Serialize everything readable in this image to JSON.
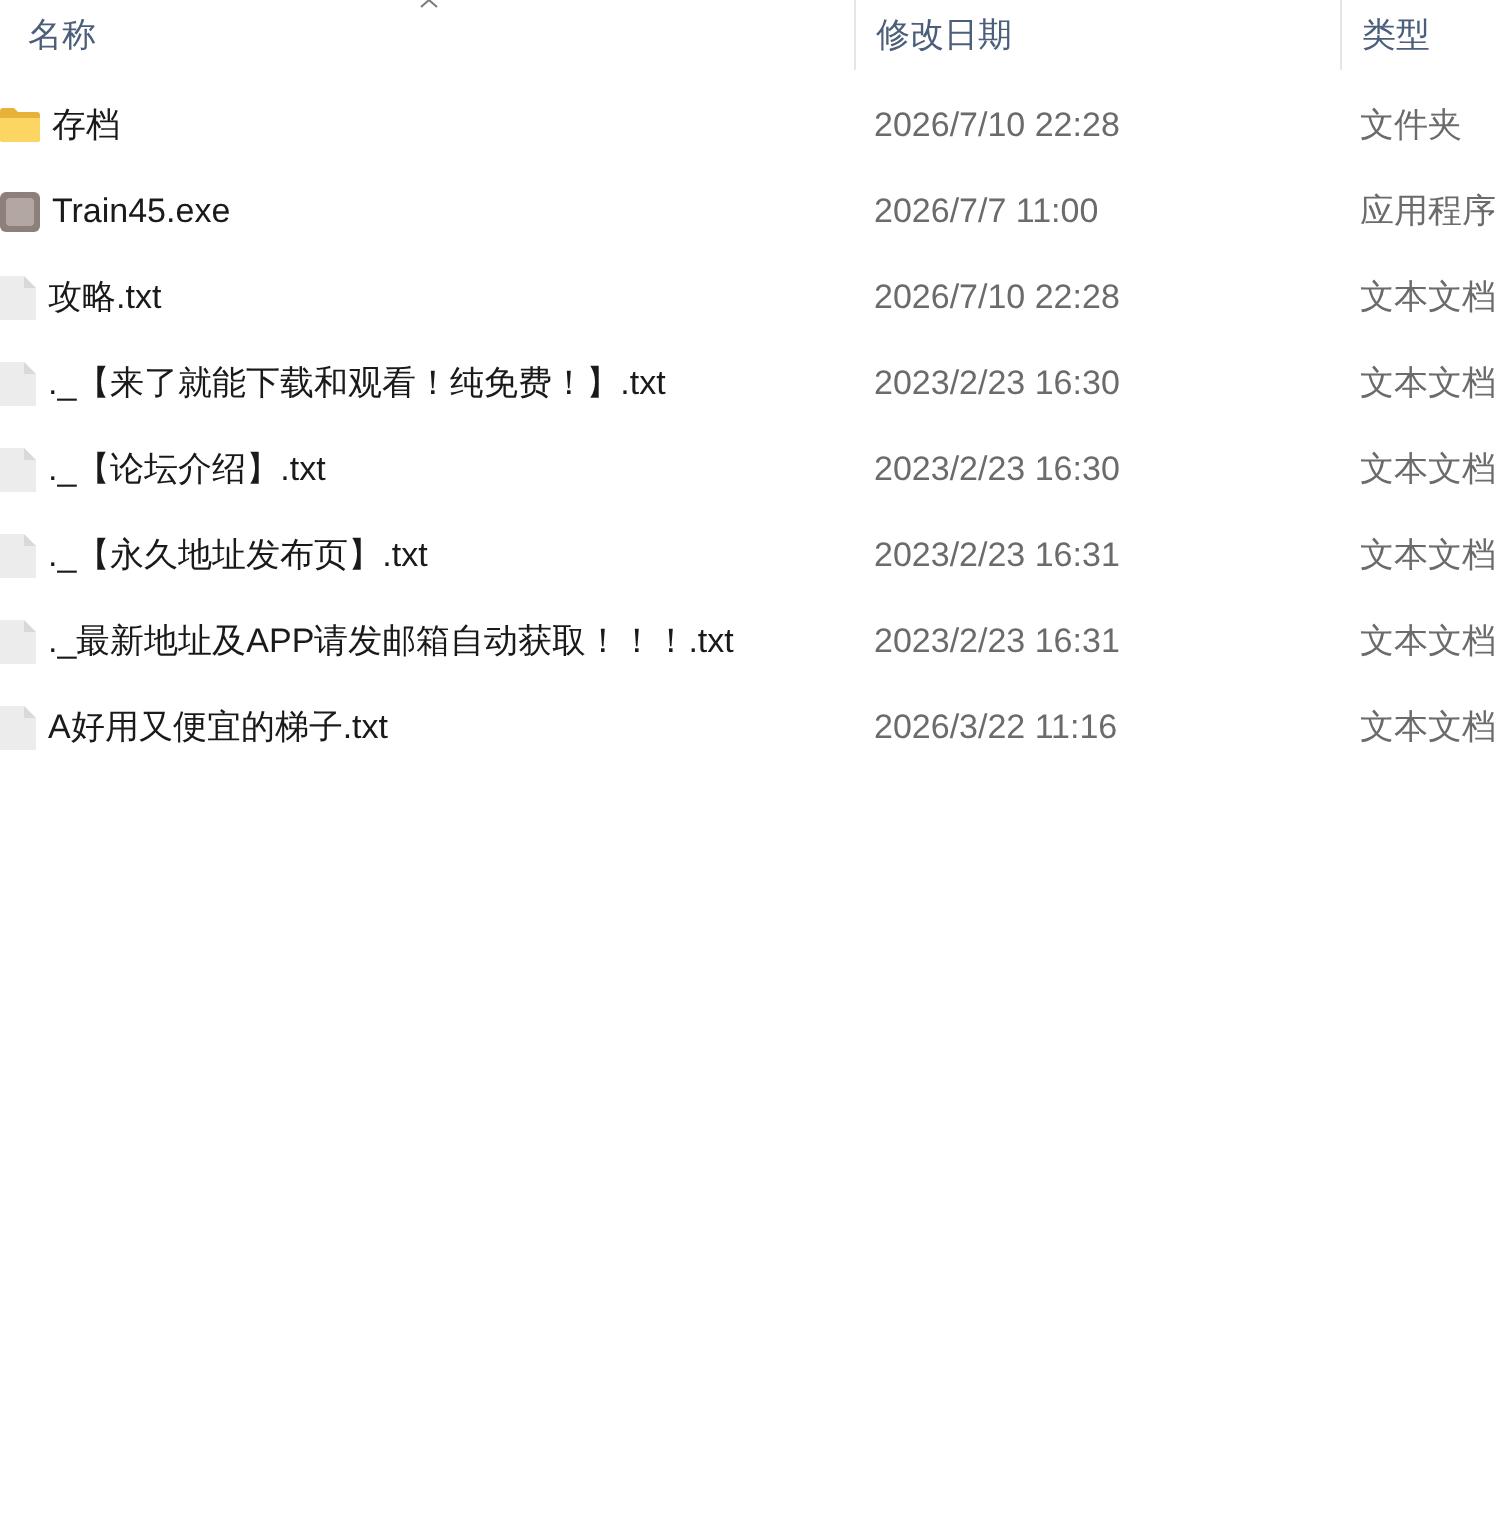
{
  "header": {
    "columns": [
      {
        "label": "名称",
        "sorted": true
      },
      {
        "label": "修改日期",
        "sorted": false
      },
      {
        "label": "类型",
        "sorted": false
      }
    ]
  },
  "files": [
    {
      "kind": "folder",
      "name": "存档",
      "modified": "2026/7/10 22:28",
      "type": "文件夹"
    },
    {
      "kind": "app",
      "name": "Train45.exe",
      "modified": "2026/7/7 11:00",
      "type": "应用程序"
    },
    {
      "kind": "text",
      "name": "攻略.txt",
      "modified": "2026/7/10 22:28",
      "type": "文本文档"
    },
    {
      "kind": "text",
      "name": "._【来了就能下载和观看！纯免费！】.txt",
      "modified": "2023/2/23 16:30",
      "type": "文本文档"
    },
    {
      "kind": "text",
      "name": "._【论坛介绍】.txt",
      "modified": "2023/2/23 16:30",
      "type": "文本文档"
    },
    {
      "kind": "text",
      "name": "._【永久地址发布页】.txt",
      "modified": "2023/2/23 16:31",
      "type": "文本文档"
    },
    {
      "kind": "text",
      "name": "._最新地址及APP请发邮箱自动获取！！！.txt",
      "modified": "2023/2/23 16:31",
      "type": "文本文档"
    },
    {
      "kind": "text",
      "name": "A好用又便宜的梯子.txt",
      "modified": "2026/3/22 11:16",
      "type": "文本文档"
    }
  ]
}
